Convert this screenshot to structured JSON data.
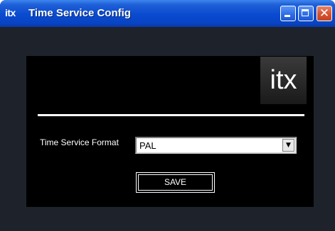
{
  "window": {
    "icon_label": "itx",
    "title": "Time Service Config",
    "controls": {
      "minimize": "minimize-icon",
      "maximize": "maximize-icon",
      "close": "close-icon"
    }
  },
  "logo": {
    "text": "itx"
  },
  "form": {
    "format_label": "Time Service Format",
    "format_value": "PAL",
    "save_label": "SAVE"
  },
  "colors": {
    "titlebar": "#0a4ad0",
    "panel": "#000000",
    "frame": "#1e232b",
    "close_button": "#d5522f"
  }
}
